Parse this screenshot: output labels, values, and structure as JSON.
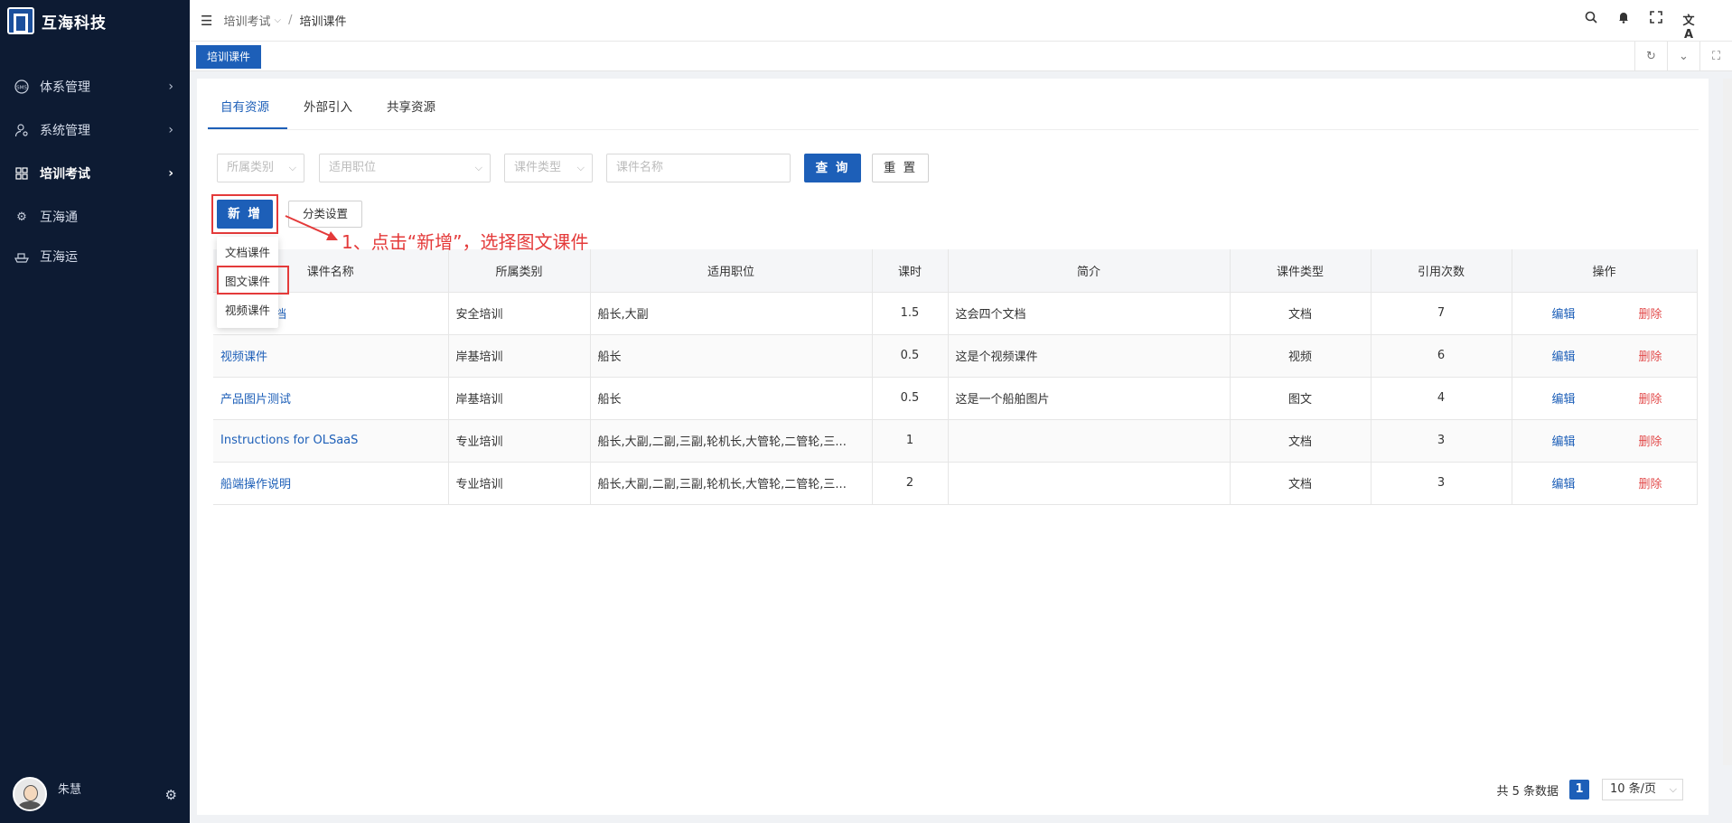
{
  "app": {
    "title": "互海科技"
  },
  "sidebar": {
    "items": [
      {
        "label": "体系管理",
        "icon": "sms-icon"
      },
      {
        "label": "系统管理",
        "icon": "user-gear-icon"
      },
      {
        "label": "培训考试",
        "icon": "grid-icon"
      },
      {
        "label": "互海通",
        "icon": "gear-icon"
      },
      {
        "label": "互海运",
        "icon": "ship-icon"
      }
    ],
    "user": {
      "name": "朱慧"
    }
  },
  "breadcrumb": {
    "parent": "培训考试",
    "current": "培训课件",
    "sep": "/"
  },
  "tagbar": {
    "active_tag": "培训课件"
  },
  "tabs": [
    "自有资源",
    "外部引入",
    "共享资源"
  ],
  "filters": {
    "category": "所属类别",
    "position": "适用职位",
    "type": "课件类型",
    "name_placeholder": "课件名称"
  },
  "buttons": {
    "query": "查 询",
    "reset": "重 置",
    "add": "新 增",
    "category_setting": "分类设置"
  },
  "dropdown": [
    "文档课件",
    "图文课件",
    "视频课件"
  ],
  "annotation": "1、点击“新增”，选择图文课件",
  "table": {
    "headers": [
      "课件名称",
      "所属类别",
      "适用职位",
      "课时",
      "简介",
      "课件类型",
      "引用次数",
      "操作"
    ],
    "rows": [
      {
        "name": "档",
        "category": "安全培训",
        "position": "船长,大副",
        "hours": "1.5",
        "intro": "这会四个文档",
        "type": "文档",
        "refs": "7"
      },
      {
        "name": "视频课件",
        "category": "岸基培训",
        "position": "船长",
        "hours": "0.5",
        "intro": "这是个视频课件",
        "type": "视频",
        "refs": "6"
      },
      {
        "name": "产品图片测试",
        "category": "岸基培训",
        "position": "船长",
        "hours": "0.5",
        "intro": "这是一个船舶图片",
        "type": "图文",
        "refs": "4"
      },
      {
        "name": "Instructions for OLSaaS",
        "category": "专业培训",
        "position": "船长,大副,二副,三副,轮机长,大管轮,二管轮,三...",
        "hours": "1",
        "intro": "",
        "type": "文档",
        "refs": "3"
      },
      {
        "name": "船端操作说明",
        "category": "专业培训",
        "position": "船长,大副,二副,三副,轮机长,大管轮,二管轮,三...",
        "hours": "2",
        "intro": "",
        "type": "文档",
        "refs": "3"
      }
    ],
    "edit_label": "编辑",
    "delete_label": "删除"
  },
  "pagination": {
    "total_text": "共 5 条数据",
    "current_page": "1",
    "page_size": "10 条/页"
  },
  "colors": {
    "sidebar_bg": "#0d1b33",
    "primary": "#1d5fb8",
    "danger": "#e24b4b",
    "annotation": "#e43a3a"
  }
}
